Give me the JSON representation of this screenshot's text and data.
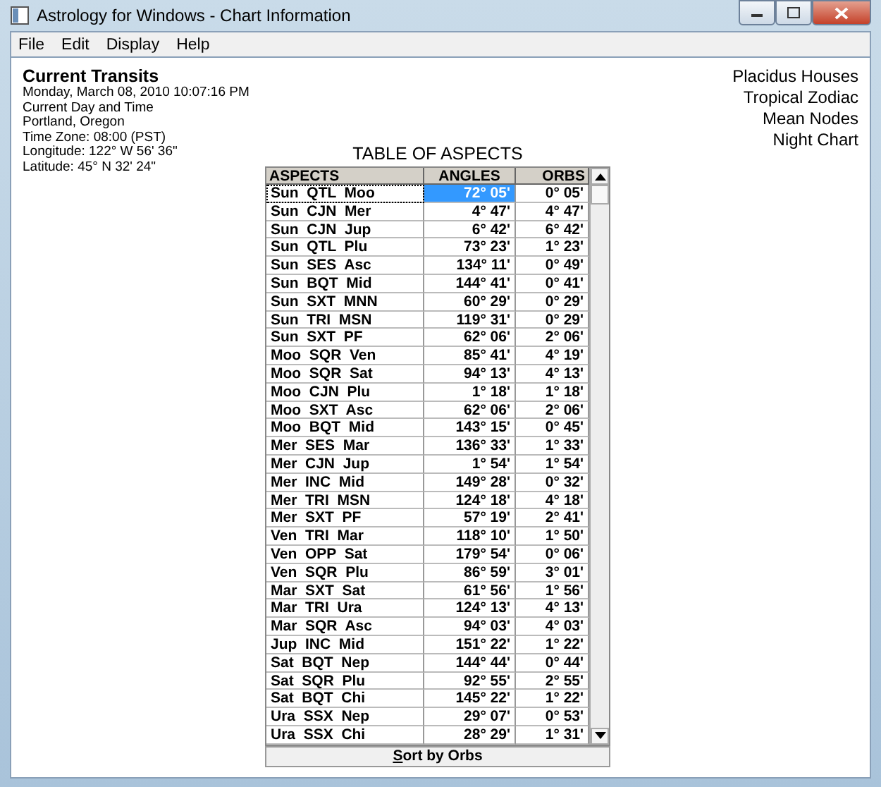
{
  "window": {
    "title": "Astrology for Windows - Chart Information"
  },
  "menu": [
    "File",
    "Edit",
    "Display",
    "Help"
  ],
  "chart_info": {
    "heading": "Current Transits",
    "lines": [
      "Monday, March 08, 2010  10:07:16 PM",
      "Current Day and Time",
      "Portland, Oregon",
      "Time Zone:  08:00 (PST)",
      "Longitude:  122° W 56' 36\"",
      "Latitude:  45° N 32' 24\""
    ]
  },
  "chart_settings": [
    "Placidus Houses",
    "Tropical Zodiac",
    "Mean Nodes",
    "Night Chart"
  ],
  "table": {
    "title": "TABLE OF ASPECTS",
    "columns": [
      "ASPECTS",
      "ANGLES",
      "ORBS"
    ],
    "rows": [
      {
        "aspect": "Sun  QTL  Moo",
        "angle": "72° 05'",
        "orb": "0° 05'",
        "selected": true
      },
      {
        "aspect": "Sun  CJN  Mer",
        "angle": "4° 47'",
        "orb": "4° 47'",
        "selected": false
      },
      {
        "aspect": "Sun  CJN  Jup",
        "angle": "6° 42'",
        "orb": "6° 42'",
        "selected": false
      },
      {
        "aspect": "Sun  QTL  Plu",
        "angle": "73° 23'",
        "orb": "1° 23'",
        "selected": false
      },
      {
        "aspect": "Sun  SES  Asc",
        "angle": "134° 11'",
        "orb": "0° 49'",
        "selected": false
      },
      {
        "aspect": "Sun  BQT  Mid",
        "angle": "144° 41'",
        "orb": "0° 41'",
        "selected": false
      },
      {
        "aspect": "Sun  SXT  MNN",
        "angle": "60° 29'",
        "orb": "0° 29'",
        "selected": false
      },
      {
        "aspect": "Sun  TRI  MSN",
        "angle": "119° 31'",
        "orb": "0° 29'",
        "selected": false
      },
      {
        "aspect": "Sun  SXT  PF",
        "angle": "62° 06'",
        "orb": "2° 06'",
        "selected": false
      },
      {
        "aspect": "Moo  SQR  Ven",
        "angle": "85° 41'",
        "orb": "4° 19'",
        "selected": false
      },
      {
        "aspect": "Moo  SQR  Sat",
        "angle": "94° 13'",
        "orb": "4° 13'",
        "selected": false
      },
      {
        "aspect": "Moo  CJN  Plu",
        "angle": "1° 18'",
        "orb": "1° 18'",
        "selected": false
      },
      {
        "aspect": "Moo  SXT  Asc",
        "angle": "62° 06'",
        "orb": "2° 06'",
        "selected": false
      },
      {
        "aspect": "Moo  BQT  Mid",
        "angle": "143° 15'",
        "orb": "0° 45'",
        "selected": false
      },
      {
        "aspect": "Mer  SES  Mar",
        "angle": "136° 33'",
        "orb": "1° 33'",
        "selected": false
      },
      {
        "aspect": "Mer  CJN  Jup",
        "angle": "1° 54'",
        "orb": "1° 54'",
        "selected": false
      },
      {
        "aspect": "Mer  INC  Mid",
        "angle": "149° 28'",
        "orb": "0° 32'",
        "selected": false
      },
      {
        "aspect": "Mer  TRI  MSN",
        "angle": "124° 18'",
        "orb": "4° 18'",
        "selected": false
      },
      {
        "aspect": "Mer  SXT  PF",
        "angle": "57° 19'",
        "orb": "2° 41'",
        "selected": false
      },
      {
        "aspect": "Ven  TRI  Mar",
        "angle": "118° 10'",
        "orb": "1° 50'",
        "selected": false
      },
      {
        "aspect": "Ven  OPP  Sat",
        "angle": "179° 54'",
        "orb": "0° 06'",
        "selected": false
      },
      {
        "aspect": "Ven  SQR  Plu",
        "angle": "86° 59'",
        "orb": "3° 01'",
        "selected": false
      },
      {
        "aspect": "Mar  SXT  Sat",
        "angle": "61° 56'",
        "orb": "1° 56'",
        "selected": false
      },
      {
        "aspect": "Mar  TRI  Ura",
        "angle": "124° 13'",
        "orb": "4° 13'",
        "selected": false
      },
      {
        "aspect": "Mar  SQR  Asc",
        "angle": "94° 03'",
        "orb": "4° 03'",
        "selected": false
      },
      {
        "aspect": "Jup  INC  Mid",
        "angle": "151° 22'",
        "orb": "1° 22'",
        "selected": false
      },
      {
        "aspect": "Sat  BQT  Nep",
        "angle": "144° 44'",
        "orb": "0° 44'",
        "selected": false
      },
      {
        "aspect": "Sat  SQR  Plu",
        "angle": "92° 55'",
        "orb": "2° 55'",
        "selected": false
      },
      {
        "aspect": "Sat  BQT  Chi",
        "angle": "145° 22'",
        "orb": "1° 22'",
        "selected": false
      },
      {
        "aspect": "Ura  SSX  Nep",
        "angle": "29° 07'",
        "orb": "0° 53'",
        "selected": false
      },
      {
        "aspect": "Ura  SSX  Chi",
        "angle": "28° 29'",
        "orb": "1° 31'",
        "selected": false
      }
    ]
  },
  "sort_button": "Sort by Orbs"
}
